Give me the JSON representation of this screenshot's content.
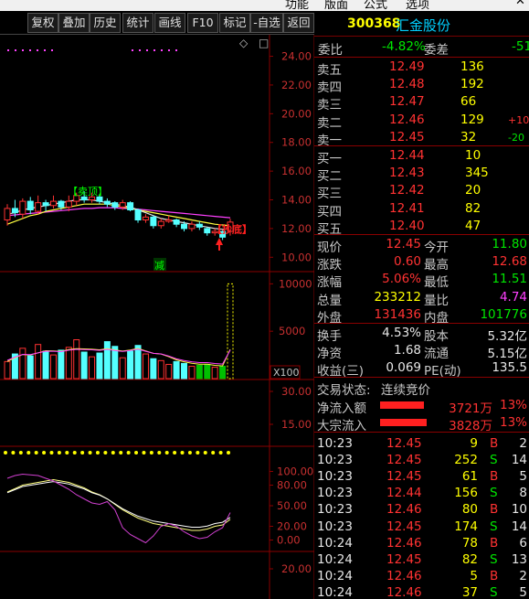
{
  "menu": [
    "功能",
    "版面",
    "公式",
    "选项"
  ],
  "toolbar": [
    "复权",
    "叠加",
    "历史",
    "统计",
    "画线",
    "F10",
    "标记",
    "-自选",
    "返回"
  ],
  "stock": {
    "code": "300368",
    "name": "汇金股份"
  },
  "weibi": {
    "label1": "委比",
    "value1": "-4.82%",
    "label2": "委差",
    "value2": "-51"
  },
  "asks": [
    {
      "label": "卖五",
      "price": "12.49",
      "vol": "136",
      "chg": ""
    },
    {
      "label": "卖四",
      "price": "12.48",
      "vol": "192",
      "chg": ""
    },
    {
      "label": "卖三",
      "price": "12.47",
      "vol": "66",
      "chg": ""
    },
    {
      "label": "卖二",
      "price": "12.46",
      "vol": "129",
      "chg": "+10"
    },
    {
      "label": "卖一",
      "price": "12.45",
      "vol": "32",
      "chg": "-20"
    }
  ],
  "bids": [
    {
      "label": "买一",
      "price": "12.44",
      "vol": "10"
    },
    {
      "label": "买二",
      "price": "12.43",
      "vol": "345"
    },
    {
      "label": "买三",
      "price": "12.42",
      "vol": "20"
    },
    {
      "label": "买四",
      "price": "12.41",
      "vol": "82"
    },
    {
      "label": "买五",
      "price": "12.40",
      "vol": "47"
    }
  ],
  "quote": [
    {
      "l1": "现价",
      "v1": "12.45",
      "l2": "今开",
      "v2": "11.80"
    },
    {
      "l1": "涨跌",
      "v1": "0.60",
      "l2": "最高",
      "v2": "12.68"
    },
    {
      "l1": "涨幅",
      "v1": "5.06%",
      "l2": "最低",
      "v2": "11.51"
    },
    {
      "l1": "总量",
      "v1": "233212",
      "l2": "量比",
      "v2": "4.74"
    },
    {
      "l1": "外盘",
      "v1": "131436",
      "l2": "内盘",
      "v2": "101776"
    }
  ],
  "fin": [
    {
      "l1": "换手",
      "v1": "4.53%",
      "l2": "股本",
      "v2": "5.32亿"
    },
    {
      "l1": "净资",
      "v1": "1.68",
      "l2": "流通",
      "v2": "5.15亿"
    },
    {
      "l1": "收益(三)",
      "v1": "0.069",
      "l2": "PE(动)",
      "v2": "135.5"
    }
  ],
  "status": {
    "label": "交易状态:",
    "value": "连续竞价"
  },
  "flows": [
    {
      "label": "净流入额",
      "value": "3721万",
      "pct": "13%",
      "fill": 0.87
    },
    {
      "label": "大宗流入",
      "value": "3828万",
      "pct": "13%",
      "fill": 0.93
    }
  ],
  "ticks": [
    {
      "time": "10:23",
      "price": "12.45",
      "vol": "9",
      "side": "B",
      "n": "2"
    },
    {
      "time": "10:23",
      "price": "12.45",
      "vol": "252",
      "side": "S",
      "n": "14"
    },
    {
      "time": "10:23",
      "price": "12.45",
      "vol": "61",
      "side": "B",
      "n": "5"
    },
    {
      "time": "10:23",
      "price": "12.44",
      "vol": "156",
      "side": "S",
      "n": "8"
    },
    {
      "time": "10:23",
      "price": "12.46",
      "vol": "80",
      "side": "B",
      "n": "10"
    },
    {
      "time": "10:23",
      "price": "12.45",
      "vol": "174",
      "side": "S",
      "n": "14"
    },
    {
      "time": "10:24",
      "price": "12.46",
      "vol": "78",
      "side": "B",
      "n": "6"
    },
    {
      "time": "10:24",
      "price": "12.45",
      "vol": "82",
      "side": "S",
      "n": "13"
    },
    {
      "time": "10:24",
      "price": "12.46",
      "vol": "5",
      "side": "B",
      "n": "2"
    },
    {
      "time": "10:24",
      "price": "12.46",
      "vol": "37",
      "side": "S",
      "n": "5"
    }
  ],
  "chart_data": {
    "type": "candlestick",
    "price_axis": [
      "24.00",
      "22.00",
      "20.00",
      "18.00",
      "16.00",
      "14.00",
      "12.00",
      "10.00"
    ],
    "price_range": [
      9.0,
      25.5
    ],
    "volume_axis": [
      "10000",
      "5000"
    ],
    "volume_unit": "X100",
    "ind1_axis": [
      "30.00",
      "15.00"
    ],
    "ind2_axis": [
      "100.00",
      "80.00",
      "50.00",
      "20.00",
      "0.00"
    ],
    "ind3_axis": [
      "20.00"
    ],
    "labels": {
      "top": "【卖顶】",
      "bottom": "【抄底】",
      "reduce": "减"
    },
    "candles": [
      {
        "o": 12.6,
        "c": 13.4,
        "h": 13.7,
        "l": 12.2
      },
      {
        "o": 13.4,
        "c": 13.1,
        "h": 14.0,
        "l": 12.8
      },
      {
        "o": 13.0,
        "c": 13.9,
        "h": 14.1,
        "l": 12.7
      },
      {
        "o": 13.9,
        "c": 13.3,
        "h": 14.2,
        "l": 13.0
      },
      {
        "o": 13.2,
        "c": 13.8,
        "h": 14.3,
        "l": 13.0
      },
      {
        "o": 13.8,
        "c": 13.6,
        "h": 14.0,
        "l": 13.2
      },
      {
        "o": 13.6,
        "c": 13.9,
        "h": 14.3,
        "l": 13.4
      },
      {
        "o": 13.9,
        "c": 13.5,
        "h": 14.0,
        "l": 13.3
      },
      {
        "o": 13.5,
        "c": 13.9,
        "h": 14.3,
        "l": 13.2
      },
      {
        "o": 13.9,
        "c": 14.3,
        "h": 14.5,
        "l": 13.6
      },
      {
        "o": 14.2,
        "c": 14.0,
        "h": 14.6,
        "l": 13.8
      },
      {
        "o": 14.0,
        "c": 14.2,
        "h": 14.5,
        "l": 13.8
      },
      {
        "o": 14.2,
        "c": 13.9,
        "h": 14.4,
        "l": 13.7
      },
      {
        "o": 13.9,
        "c": 13.7,
        "h": 14.1,
        "l": 13.5
      },
      {
        "o": 13.8,
        "c": 13.5,
        "h": 13.9,
        "l": 13.3
      },
      {
        "o": 13.5,
        "c": 13.8,
        "h": 14.0,
        "l": 13.3
      },
      {
        "o": 13.8,
        "c": 13.3,
        "h": 13.9,
        "l": 13.2
      },
      {
        "o": 13.3,
        "c": 12.6,
        "h": 13.4,
        "l": 12.4
      },
      {
        "o": 12.6,
        "c": 12.8,
        "h": 13.0,
        "l": 12.4
      },
      {
        "o": 12.8,
        "c": 12.2,
        "h": 12.9,
        "l": 12.0
      },
      {
        "o": 12.2,
        "c": 12.5,
        "h": 12.7,
        "l": 12.0
      },
      {
        "o": 12.5,
        "c": 12.6,
        "h": 12.9,
        "l": 12.4
      },
      {
        "o": 12.6,
        "c": 12.3,
        "h": 12.7,
        "l": 12.1
      },
      {
        "o": 12.3,
        "c": 12.0,
        "h": 12.5,
        "l": 11.8
      },
      {
        "o": 12.0,
        "c": 12.3,
        "h": 12.5,
        "l": 11.8
      },
      {
        "o": 12.3,
        "c": 12.1,
        "h": 12.5,
        "l": 11.9
      },
      {
        "o": 12.0,
        "c": 11.7,
        "h": 12.1,
        "l": 11.5
      },
      {
        "o": 11.7,
        "c": 11.8,
        "h": 12.0,
        "l": 11.5
      },
      {
        "o": 11.8,
        "c": 11.4,
        "h": 11.9,
        "l": 11.2
      },
      {
        "o": 11.8,
        "c": 12.45,
        "h": 12.68,
        "l": 11.51
      }
    ],
    "volume": [
      1800,
      2600,
      3200,
      2400,
      3600,
      2900,
      2500,
      3000,
      3300,
      4100,
      2800,
      2300,
      2700,
      3900,
      3400,
      2200,
      2900,
      3500,
      2600,
      2100,
      1900,
      1500,
      1800,
      1600,
      1300,
      1400,
      1500,
      1200,
      1300,
      10000
    ],
    "ma5": [
      13.0,
      13.1,
      13.3,
      13.4,
      13.5,
      13.6,
      13.7,
      13.8,
      13.9,
      14.0,
      14.0,
      14.0,
      13.9,
      13.8,
      13.7,
      13.6,
      13.5,
      13.3,
      13.1,
      12.9,
      12.7,
      12.6,
      12.5,
      12.4,
      12.3,
      12.2,
      12.1,
      12.0,
      11.95,
      12.0
    ],
    "ma10": [
      12.3,
      12.5,
      12.7,
      12.9,
      13.0,
      13.2,
      13.3,
      13.4,
      13.5,
      13.6,
      13.7,
      13.7,
      13.7,
      13.7,
      13.6,
      13.5,
      13.4,
      13.3,
      13.2,
      13.1,
      13.0,
      12.9,
      12.8,
      12.7,
      12.6,
      12.5,
      12.4,
      12.3,
      12.25,
      12.2
    ],
    "ma20": [
      12.9,
      12.95,
      13.0,
      13.05,
      13.1,
      13.15,
      13.2,
      13.25,
      13.3,
      13.35,
      13.4,
      13.4,
      13.45,
      13.45,
      13.45,
      13.4,
      13.4,
      13.35,
      13.3,
      13.25,
      13.2,
      13.15,
      13.1,
      13.05,
      13.0,
      12.95,
      12.9,
      12.85,
      12.8,
      12.75
    ],
    "kdj_k": [
      70,
      75,
      80,
      82,
      84,
      86,
      88,
      86,
      84,
      80,
      76,
      70,
      66,
      60,
      52,
      44,
      38,
      32,
      28,
      24,
      22,
      20,
      18,
      16,
      14,
      14,
      16,
      20,
      22,
      30
    ],
    "kdj_j": [
      90,
      94,
      96,
      95,
      94,
      90,
      86,
      80,
      74,
      66,
      60,
      54,
      52,
      56,
      44,
      18,
      8,
      2,
      -4,
      6,
      20,
      24,
      20,
      12,
      6,
      2,
      4,
      12,
      18,
      40
    ]
  }
}
